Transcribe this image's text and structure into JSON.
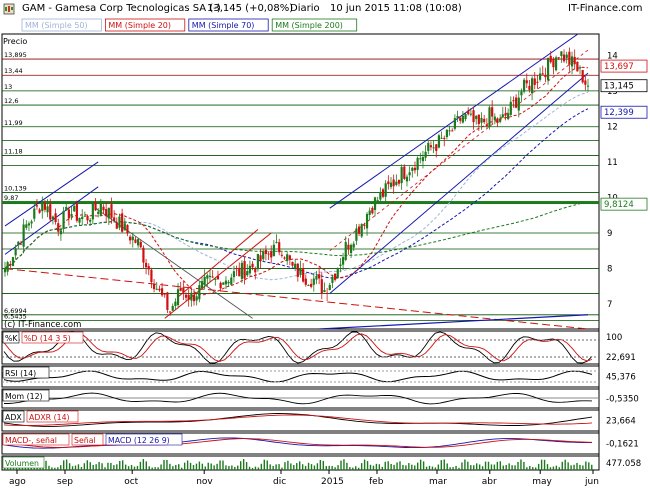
{
  "header": {
    "instrument": "GAM - Gamesa Corp Tecnologicas SA (-)",
    "last": "13,145 (+0,08%)",
    "period": "Diario",
    "datetime": "10 jun 2015 11:08 (10:08)",
    "brand": "IT-Finance.com"
  },
  "watermark": "(c) IT-Finance.com",
  "price_label": "Precio",
  "colors": {
    "up": "#1c7a1c",
    "down": "#d01010",
    "ma50": "#9fb3d8",
    "ma20": "#d01010",
    "ma70": "#1616b0",
    "ma200": "#1c7a1c",
    "channel": "#1616b0"
  },
  "main_legend": [
    {
      "label": "MM (Simple 50)",
      "color": "#9fb3d8"
    },
    {
      "label": "MM (Simple 20)",
      "color": "#d01010"
    },
    {
      "label": "MM (Simple 70)",
      "color": "#1616b0"
    },
    {
      "label": "MM (Simple 200)",
      "color": "#1c7a1c"
    }
  ],
  "left_axis_labels": [
    "13,895",
    "13,44",
    "13",
    "12,6",
    "11,99",
    "11,18",
    "10,139",
    "9,87",
    "6,6994",
    "6,5435"
  ],
  "right_axis_ticks": [
    "14",
    "13",
    "12",
    "11",
    "10",
    "9",
    "8",
    "7"
  ],
  "right_value_boxes": [
    {
      "text": "13,697",
      "color": "#d01010"
    },
    {
      "text": "13,145",
      "color": "#000000"
    },
    {
      "text": "12,399",
      "color": "#1616b0"
    },
    {
      "text": "9,8124",
      "color": "#1c7a1c"
    }
  ],
  "months": [
    "ago",
    "sep",
    "oct",
    "nov",
    "dic",
    "2015",
    "feb",
    "mar",
    "abr",
    "may",
    "jun"
  ],
  "indicators": [
    {
      "key": "stoch",
      "legend": [
        {
          "label": "%K",
          "color": "#000000"
        },
        {
          "label": "%D (14 3 5)",
          "color": "#d01010"
        }
      ],
      "ticks": [
        "100",
        "22,691"
      ]
    },
    {
      "key": "rsi",
      "legend": [
        {
          "label": "RSI (14)",
          "color": "#000000"
        }
      ],
      "ticks": [
        "45,376"
      ]
    },
    {
      "key": "mom",
      "legend": [
        {
          "label": "Mom (12)",
          "color": "#000000"
        }
      ],
      "ticks": [
        "-0,5350"
      ]
    },
    {
      "key": "adx",
      "legend": [
        {
          "label": "ADX",
          "color": "#000000"
        },
        {
          "label": "ADXR (14)",
          "color": "#d01010"
        }
      ],
      "ticks": [
        "23,664"
      ]
    },
    {
      "key": "macd",
      "legend": [
        {
          "label": "MACD-, señal",
          "color": "#d01010"
        },
        {
          "label": "Señal",
          "color": "#d01010"
        },
        {
          "label": "MACD (12 26 9)",
          "color": "#1616b0"
        }
      ],
      "ticks": [
        "-0,1621"
      ]
    },
    {
      "key": "vol",
      "legend": [
        {
          "label": "Volumen",
          "color": "#1c7a1c"
        }
      ],
      "ticks": [
        "477.058"
      ]
    }
  ],
  "chart_data": {
    "type": "candlestick",
    "title": "GAM - Gamesa Corp Tecnologicas SA (-)",
    "period": "Diario",
    "ylim": [
      6.3,
      14.6
    ],
    "x_months": [
      "ago",
      "sep",
      "oct",
      "nov",
      "dic",
      "2015",
      "feb",
      "mar",
      "abr",
      "may",
      "jun"
    ],
    "close_path": [
      [
        0,
        8.0
      ],
      [
        8,
        9.2
      ],
      [
        14,
        9.9
      ],
      [
        20,
        9.2
      ],
      [
        24,
        9.6
      ],
      [
        30,
        9.4
      ],
      [
        36,
        9.8
      ],
      [
        40,
        9.5
      ],
      [
        46,
        9.0
      ],
      [
        50,
        8.7
      ],
      [
        54,
        8.0
      ],
      [
        58,
        7.3
      ],
      [
        62,
        6.8
      ],
      [
        66,
        7.4
      ],
      [
        70,
        7.2
      ],
      [
        76,
        7.6
      ],
      [
        82,
        7.7
      ],
      [
        88,
        7.9
      ],
      [
        94,
        8.1
      ],
      [
        100,
        8.5
      ],
      [
        104,
        8.6
      ],
      [
        108,
        8.0
      ],
      [
        112,
        7.8
      ],
      [
        116,
        7.7
      ],
      [
        120,
        7.4
      ],
      [
        124,
        7.9
      ],
      [
        128,
        8.6
      ],
      [
        134,
        9.3
      ],
      [
        138,
        9.8
      ],
      [
        142,
        10.1
      ],
      [
        148,
        10.6
      ],
      [
        154,
        11.0
      ],
      [
        160,
        11.4
      ],
      [
        166,
        11.7
      ],
      [
        172,
        12.3
      ],
      [
        178,
        12.0
      ],
      [
        182,
        12.3
      ],
      [
        186,
        12.1
      ],
      [
        190,
        12.5
      ],
      [
        194,
        13.0
      ],
      [
        200,
        13.4
      ],
      [
        204,
        13.7
      ],
      [
        208,
        14.1
      ],
      [
        211,
        13.9
      ],
      [
        214,
        13.7
      ],
      [
        217,
        13.4
      ],
      [
        219,
        13.1
      ]
    ],
    "moving_averages": {
      "ma20_last": 13.697,
      "ma70_last": 12.399,
      "ma200_last": 9.8124,
      "last_price": 13.145
    },
    "horizontal_levels": [
      13.895,
      13.44,
      13.0,
      12.6,
      11.99,
      11.18,
      10.139,
      9.87,
      6.6994,
      6.5435
    ],
    "indicators": {
      "stochastic": {
        "k_last": 22.691,
        "params": "14 3 5"
      },
      "rsi": {
        "value": 45.376,
        "period": 14
      },
      "momentum": {
        "value": -0.535,
        "period": 12
      },
      "adx": {
        "value": 23.664,
        "period": 14
      },
      "macd": {
        "value": -0.1621,
        "params": "12 26 9"
      },
      "volume": {
        "value": 477058
      }
    }
  }
}
